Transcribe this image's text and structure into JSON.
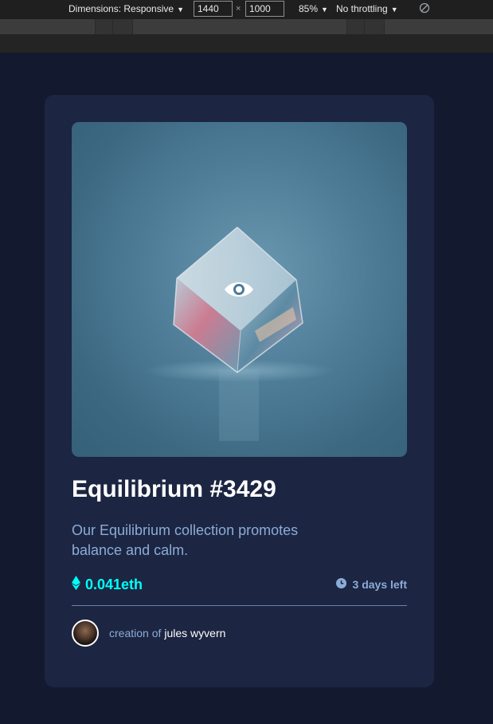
{
  "devtools": {
    "dimensions_label": "Dimensions: Responsive",
    "width_value": "1440",
    "times_sign": "×",
    "height_value": "1000",
    "zoom_label": "85%",
    "throttle_label": "No throttling",
    "caret": "▼",
    "rotate_icon": "rotate-icon"
  },
  "card": {
    "image_alt": "Equilibrium",
    "view_icon": "eye-icon",
    "title": "Equilibrium #3429",
    "description": "Our Equilibrium collection promotes balance and calm.",
    "price": "0.041eth",
    "price_icon": "ethereum-icon",
    "time_left": "3 days left",
    "time_icon": "clock-icon",
    "creator_prefix": "creation of",
    "creator_name": "jules wyvern"
  },
  "colors": {
    "page_bg": "#131a2f",
    "card_bg": "#1c2541",
    "accent_cyan": "#00fff8",
    "soft_blue": "#8bacd9",
    "white": "#ffffff"
  }
}
